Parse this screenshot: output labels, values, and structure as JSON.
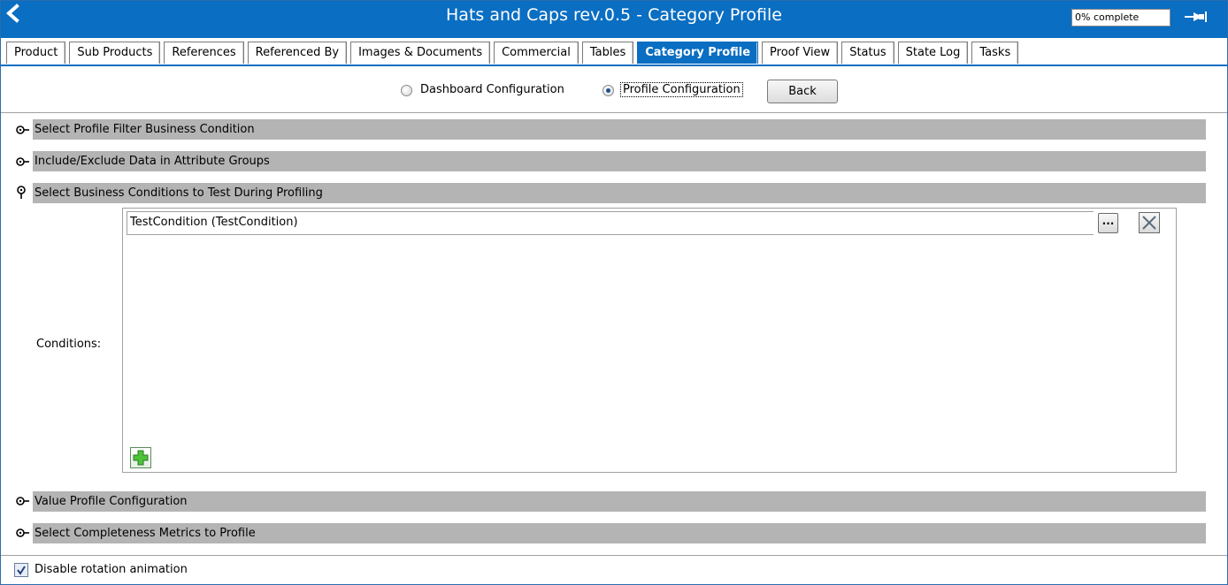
{
  "window": {
    "title": "Hats and Caps rev.0.5 - Category Profile",
    "progress": "0% complete",
    "accent_color": "#0a6ec2",
    "back_icon": "chevron-left-icon",
    "pin_icon": "pin-icon"
  },
  "tabs": [
    {
      "label": "Product",
      "active": false
    },
    {
      "label": "Sub Products",
      "active": false
    },
    {
      "label": "References",
      "active": false
    },
    {
      "label": "Referenced By",
      "active": false
    },
    {
      "label": "Images & Documents",
      "active": false
    },
    {
      "label": "Commercial",
      "active": false
    },
    {
      "label": "Tables",
      "active": false
    },
    {
      "label": "Category Profile",
      "active": true
    },
    {
      "label": "Proof View",
      "active": false
    },
    {
      "label": "Status",
      "active": false
    },
    {
      "label": "State Log",
      "active": false
    },
    {
      "label": "Tasks",
      "active": false
    }
  ],
  "config": {
    "dashboard_label": "Dashboard Configuration",
    "profile_label": "Profile Configuration",
    "selected": "Profile Configuration",
    "back_label": "Back"
  },
  "sections": {
    "filter": {
      "label": "Select Profile Filter Business Condition",
      "expanded": false
    },
    "include_exclude": {
      "label": "Include/Exclude Data in Attribute Groups",
      "expanded": false
    },
    "business_conditions": {
      "label": "Select Business Conditions to Test During Profiling",
      "expanded": true
    },
    "value_profile": {
      "label": "Value Profile Configuration",
      "expanded": false
    },
    "completeness": {
      "label": "Select Completeness Metrics to Profile",
      "expanded": false
    }
  },
  "conditions": {
    "label": "Conditions:",
    "items": [
      "TestCondition (TestCondition)"
    ],
    "browse_label": "...",
    "clear_icon": "close-icon",
    "add_icon": "plus-icon"
  },
  "footer": {
    "disable_rotation_label": "Disable rotation animation",
    "disable_rotation_checked": true
  }
}
